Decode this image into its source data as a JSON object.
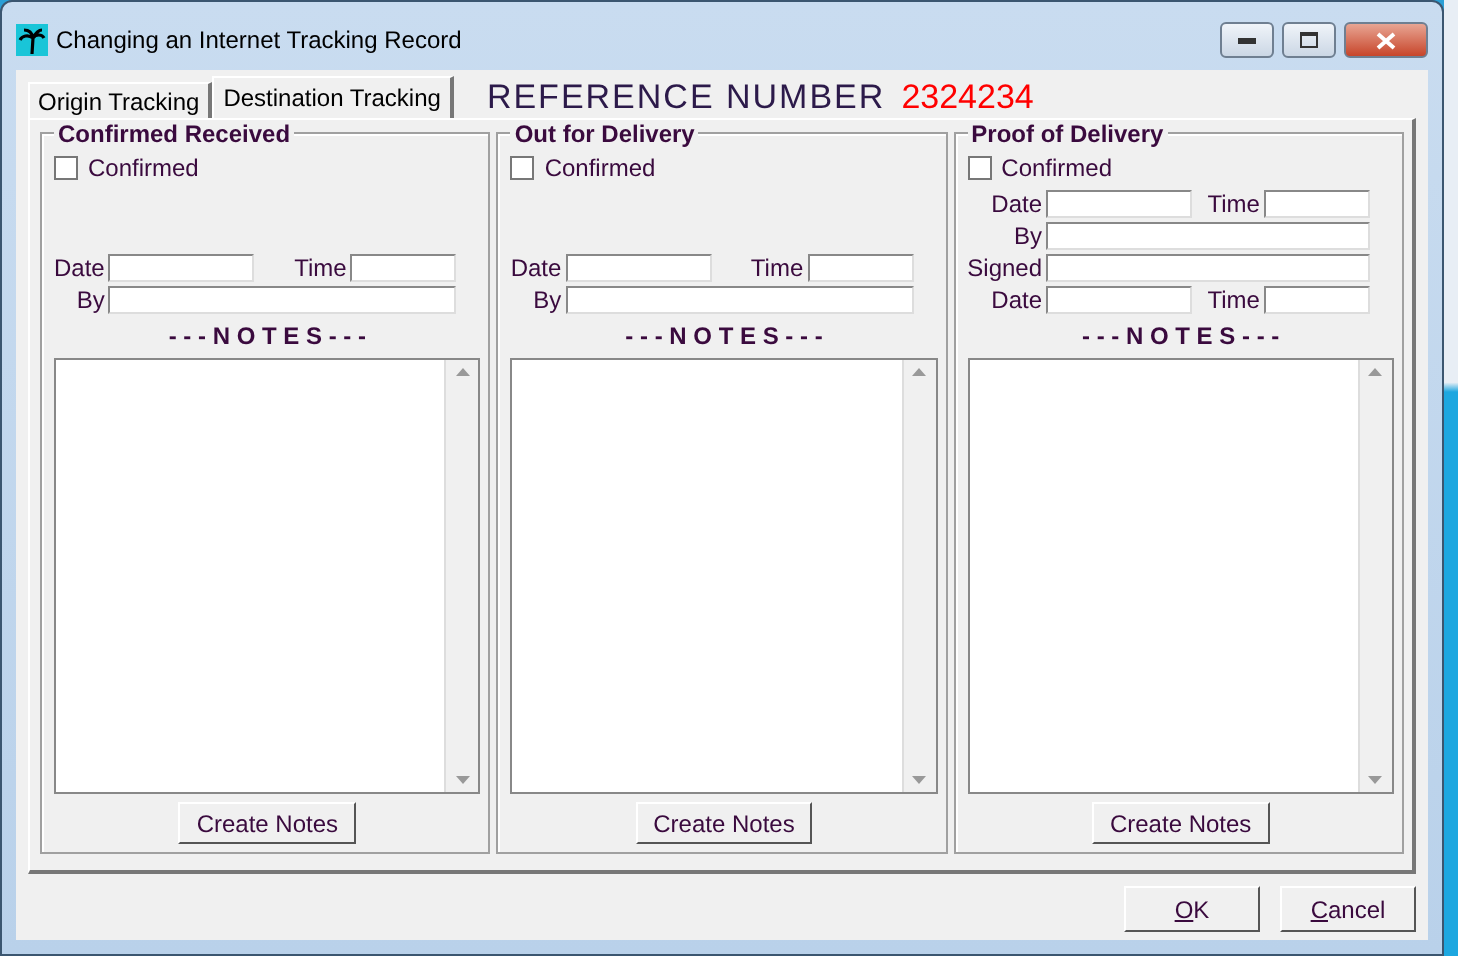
{
  "window": {
    "title": "Changing an Internet Tracking Record"
  },
  "tabs": [
    {
      "label": "Origin Tracking",
      "selected": false
    },
    {
      "label": "Destination Tracking",
      "selected": true
    }
  ],
  "reference": {
    "label": "REFERENCE NUMBER",
    "value": "2324234"
  },
  "panels": [
    {
      "title": "Confirmed Received",
      "confirm": {
        "label": "Confirmed",
        "checked": false
      },
      "rows": [
        {
          "kind": "pair",
          "labels": [
            "Date",
            "Time"
          ]
        },
        {
          "kind": "single",
          "labels": [
            "By"
          ]
        }
      ],
      "notes_heading": "- - - N O T E S - - -",
      "button": "Create Notes"
    },
    {
      "title": "Out for Delivery",
      "confirm": {
        "label": "Confirmed",
        "checked": false
      },
      "rows": [
        {
          "kind": "pair",
          "labels": [
            "Date",
            "Time"
          ]
        },
        {
          "kind": "single",
          "labels": [
            "By"
          ]
        }
      ],
      "notes_heading": "- - - N O T E S - - -",
      "button": "Create Notes"
    },
    {
      "title": "Proof of Delivery",
      "confirm": {
        "label": "Confirmed",
        "checked": false
      },
      "rows": [
        {
          "kind": "pair",
          "labels": [
            "Date",
            "Time"
          ]
        },
        {
          "kind": "single",
          "labels": [
            "By"
          ]
        },
        {
          "kind": "single",
          "labels": [
            "Signed"
          ]
        },
        {
          "kind": "pair",
          "labels": [
            "Date",
            "Time"
          ]
        }
      ],
      "notes_heading": "- - - N O T E S - - -",
      "button": "Create Notes"
    }
  ],
  "buttons": [
    {
      "access": "O",
      "rest": "K"
    },
    {
      "access": "C",
      "rest": "ancel"
    }
  ]
}
